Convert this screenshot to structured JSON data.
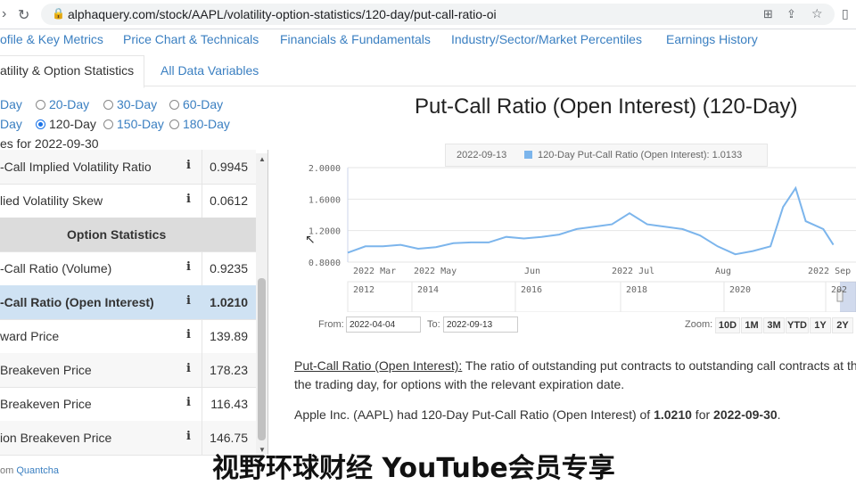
{
  "browser": {
    "url": "alphaquery.com/stock/AAPL/volatility-option-statistics/120-day/put-call-ratio-oi"
  },
  "nav": {
    "links": [
      "ofile & Key Metrics",
      "Price Chart & Technicals",
      "Financials & Fundamentals",
      "Industry/Sector/Market Percentiles",
      "Earnings History"
    ],
    "tabs": [
      "atility & Option Statistics",
      "All Data Variables"
    ]
  },
  "periods": {
    "row1": [
      "Day",
      "20-Day",
      "30-Day",
      "60-Day"
    ],
    "row2": [
      "Day",
      "120-Day",
      "150-Day",
      "180-Day"
    ],
    "selected": "120-Day"
  },
  "values_date": "es for 2022-09-30",
  "table": {
    "rows": [
      {
        "name": "-Call Implied Volatility Ratio",
        "value": "0.9945"
      },
      {
        "name": "lied Volatility Skew",
        "value": "0.0612"
      },
      {
        "name": "Option Statistics",
        "value": ""
      },
      {
        "name": "-Call Ratio (Volume)",
        "value": "0.9235"
      },
      {
        "name": "-Call Ratio (Open Interest)",
        "value": "1.0210"
      },
      {
        "name": "ward Price",
        "value": "139.89"
      },
      {
        "name": " Breakeven Price",
        "value": "178.23"
      },
      {
        "name": " Breakeven Price",
        "value": "116.43"
      },
      {
        "name": "ion Breakeven Price",
        "value": "146.75"
      }
    ],
    "info_icon": "i"
  },
  "credit": {
    "prefix": "om ",
    "link": "Quantcha"
  },
  "chart_data": {
    "type": "line",
    "title": "Put-Call Ratio (Open Interest) (120-Day)",
    "series": [
      {
        "name": "120-Day Put-Call Ratio (Open Interest)",
        "color": "#7cb5ec",
        "x": [
          "2022-03-04",
          "2022-03-11",
          "2022-03-18",
          "2022-03-25",
          "2022-04-01",
          "2022-04-08",
          "2022-04-15",
          "2022-04-22",
          "2022-04-29",
          "2022-05-06",
          "2022-05-13",
          "2022-05-20",
          "2022-05-27",
          "2022-06-03",
          "2022-06-10",
          "2022-06-17",
          "2022-06-24",
          "2022-07-01",
          "2022-07-08",
          "2022-07-15",
          "2022-07-22",
          "2022-07-29",
          "2022-08-05",
          "2022-08-12",
          "2022-08-19",
          "2022-08-24",
          "2022-08-29",
          "2022-09-02",
          "2022-09-09",
          "2022-09-13"
        ],
        "y": [
          0.92,
          1.0,
          1.0,
          1.02,
          0.97,
          0.99,
          1.04,
          1.05,
          1.05,
          1.12,
          1.1,
          1.12,
          1.15,
          1.22,
          1.25,
          1.28,
          1.42,
          1.28,
          1.25,
          1.22,
          1.14,
          1.0,
          0.9,
          0.94,
          1.0,
          1.5,
          1.74,
          1.32,
          1.22,
          1.02
        ]
      }
    ],
    "y_ticks": [
      "2.0000",
      "1.6000",
      "1.2000",
      "0.8000"
    ],
    "ylim": [
      0.8,
      2.0
    ],
    "x_ticks": [
      "2022 Mar",
      "2022 May",
      "Jun",
      "2022 Jul",
      "Aug",
      "2022 Sep"
    ],
    "navigator_ticks": [
      "2012",
      "2014",
      "2016",
      "2018",
      "2020",
      "202"
    ],
    "tooltip": {
      "date": "2022-09-13",
      "text": "120-Day Put-Call Ratio (Open Interest): 1.0133"
    },
    "grid": true
  },
  "range": {
    "from_label": "From:",
    "from": "2022-04-04",
    "to_label": "To:",
    "to": "2022-09-13",
    "zoom_label": "Zoom:",
    "zoom": [
      "10D",
      "1M",
      "3M",
      "YTD",
      "1Y",
      "2Y"
    ]
  },
  "desc": {
    "term": "Put-Call Ratio (Open Interest):",
    "line1": " The ratio of outstanding put contracts to outstanding call contracts at the",
    "line2": "the trading day, for options with the relevant expiration date.",
    "summary_pre": "Apple Inc. (AAPL) had 120-Day Put-Call Ratio (Open Interest) of ",
    "summary_value": "1.0210",
    "summary_mid": " for ",
    "summary_date": "2022-09-30",
    "summary_end": "."
  },
  "subtitle": "视野环球财经 YouTube会员专享"
}
